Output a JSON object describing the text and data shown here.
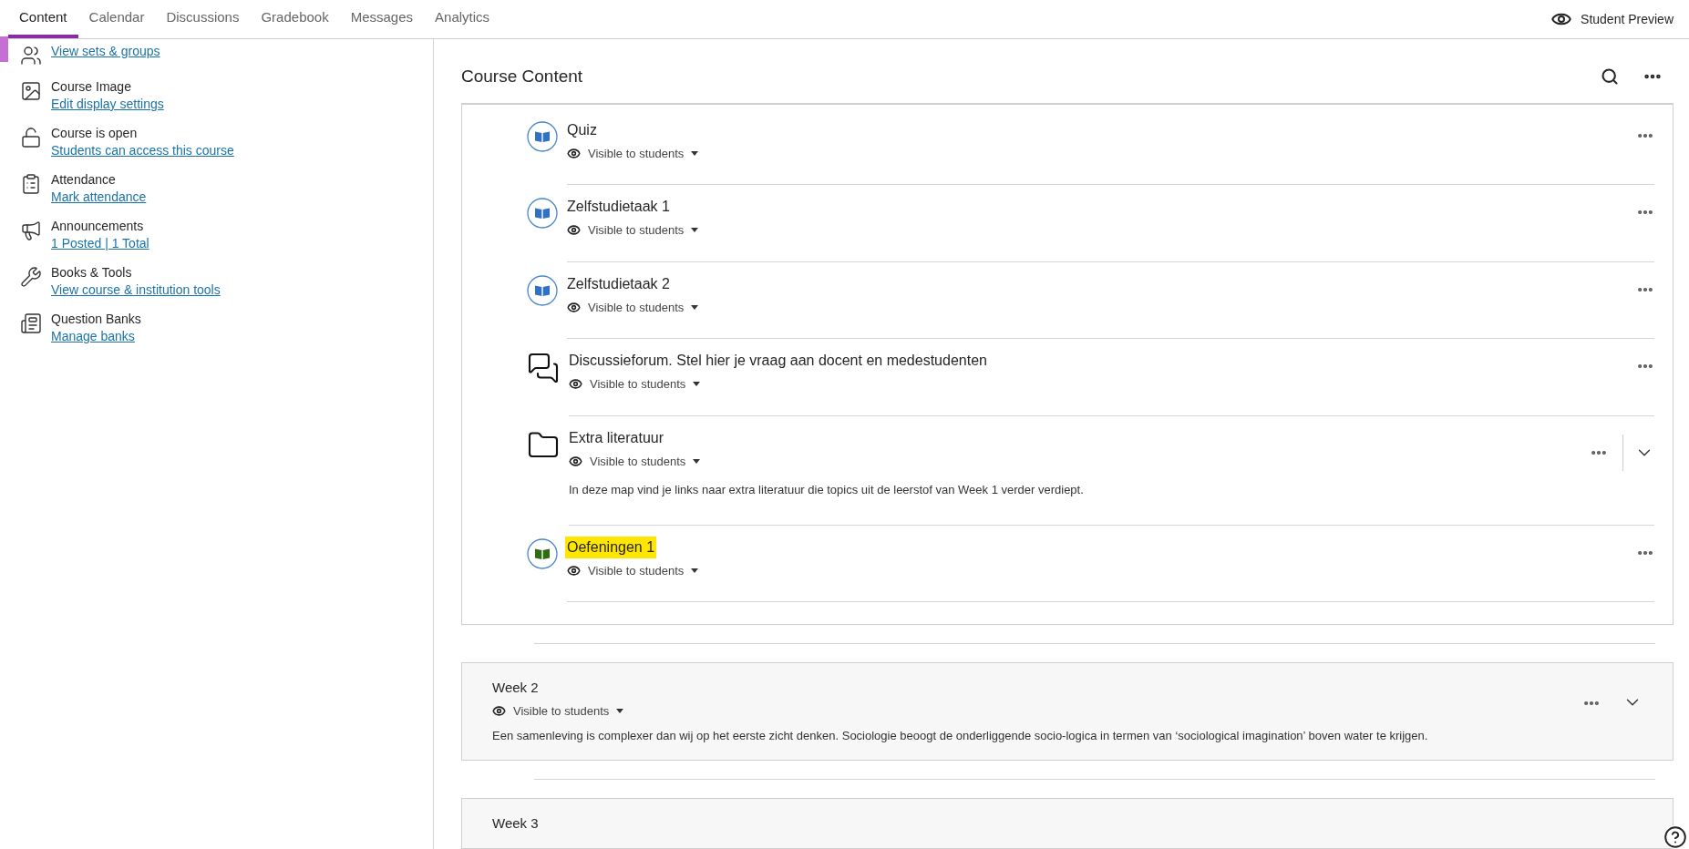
{
  "tabs": [
    {
      "label": "Content",
      "selected": true
    },
    {
      "label": "Calendar",
      "selected": false
    },
    {
      "label": "Discussions",
      "selected": false
    },
    {
      "label": "Gradebook",
      "selected": false
    },
    {
      "label": "Messages",
      "selected": false
    },
    {
      "label": "Analytics",
      "selected": false
    }
  ],
  "student_preview": "Student Preview",
  "sidebar": {
    "items": [
      {
        "kind": "groups",
        "link": "View sets & groups"
      },
      {
        "kind": "image",
        "title": "Course Image",
        "link": "Edit display settings"
      },
      {
        "kind": "lock",
        "title": "Course is open",
        "link": "Students can access this course"
      },
      {
        "kind": "attendance",
        "title": "Attendance",
        "link": "Mark attendance"
      },
      {
        "kind": "announcements",
        "title": "Announcements",
        "link": "1 Posted | 1 Total"
      },
      {
        "kind": "tools",
        "title": "Books & Tools",
        "link": "View course & institution tools"
      },
      {
        "kind": "banks",
        "title": "Question Banks",
        "link": "Manage banks"
      }
    ]
  },
  "course_content": {
    "title": "Course Content",
    "items": [
      {
        "kind": "assessment",
        "title": "Quiz",
        "visibility": "Visible to students",
        "highlighted": false
      },
      {
        "kind": "assessment",
        "title": "Zelfstudietaak 1",
        "visibility": "Visible to students",
        "highlighted": false
      },
      {
        "kind": "assessment",
        "title": "Zelfstudietaak 2",
        "visibility": "Visible to students",
        "highlighted": false
      },
      {
        "kind": "discussion",
        "title": "Discussieforum. Stel hier je vraag aan docent en medestudenten",
        "visibility": "Visible to students",
        "highlighted": false
      },
      {
        "kind": "folder",
        "title": "Extra literatuur",
        "visibility": "Visible to students",
        "description": "In deze map vind je links naar extra literatuur die topics uit de leerstof van Week 1 verder verdiept.",
        "highlighted": false
      },
      {
        "kind": "assessment",
        "title": "Oefeningen 1",
        "visibility": "Visible to students",
        "highlighted": true
      }
    ],
    "modules": [
      {
        "title": "Week 2",
        "visibility": "Visible to students",
        "description": "Een samenleving is complexer dan wij op het eerste zicht denken. Sociologie beoogt de onderliggende socio-logica in termen van ‘sociological imagination’ boven water te krijgen."
      },
      {
        "title": "Week 3"
      }
    ]
  }
}
